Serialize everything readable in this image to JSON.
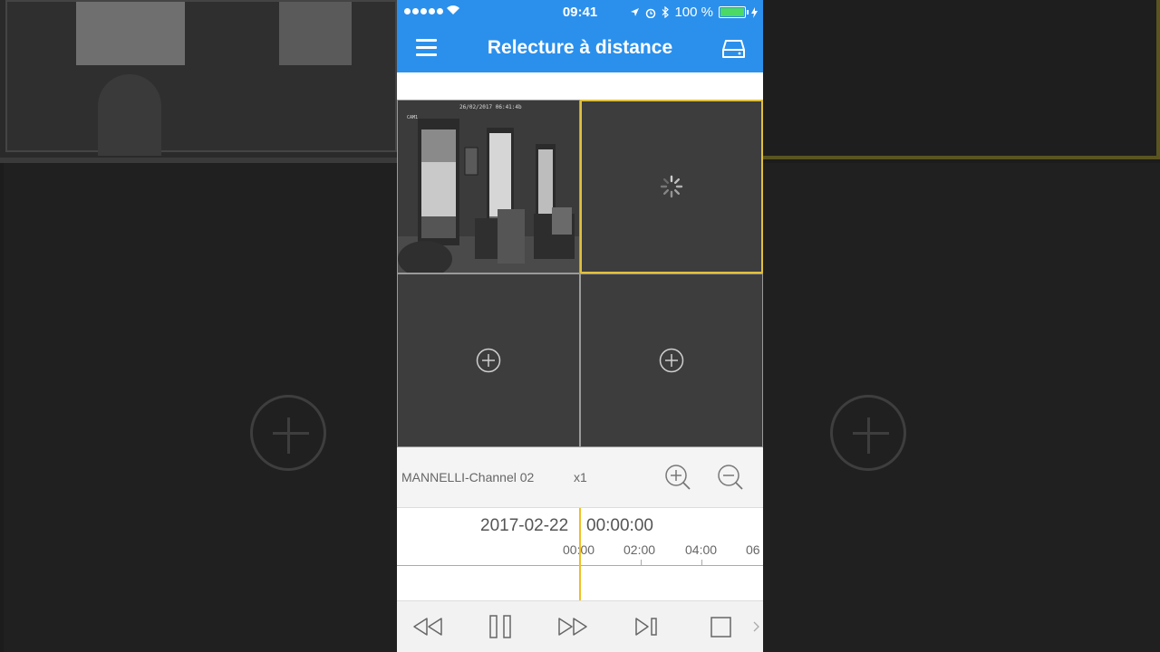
{
  "status_bar": {
    "time": "09:41",
    "battery_text": "100 %"
  },
  "nav": {
    "title": "Relecture à distance",
    "menu_icon": "hamburger-menu-icon",
    "device_icon": "hard-drive-icon"
  },
  "video_grid": {
    "cells": [
      {
        "state": "playing",
        "overlay_timestamp": "26/02/2017 06:41:4b",
        "overlay_channel": "CAM1"
      },
      {
        "state": "loading",
        "selected": true
      },
      {
        "state": "empty",
        "icon": "add-circle-icon"
      },
      {
        "state": "empty",
        "icon": "add-circle-icon"
      }
    ]
  },
  "info_bar": {
    "channel_name": "MANNELLI-Channel 02",
    "speed": "x1",
    "zoom_in_icon": "zoom-in-icon",
    "zoom_out_icon": "zoom-out-icon"
  },
  "timeline": {
    "date": "2017-02-22",
    "time": "00:00:00",
    "ticks": [
      "00:00",
      "02:00",
      "04:00",
      "06"
    ]
  },
  "controls": {
    "icons": [
      "rewind-icon",
      "pause-icon",
      "fast-forward-icon",
      "step-forward-icon",
      "stop-icon",
      "more-chevron-icon"
    ]
  },
  "colors": {
    "header_blue": "#2b90ec",
    "selection_yellow": "#e0c040",
    "timeline_cursor": "#f0c020"
  }
}
